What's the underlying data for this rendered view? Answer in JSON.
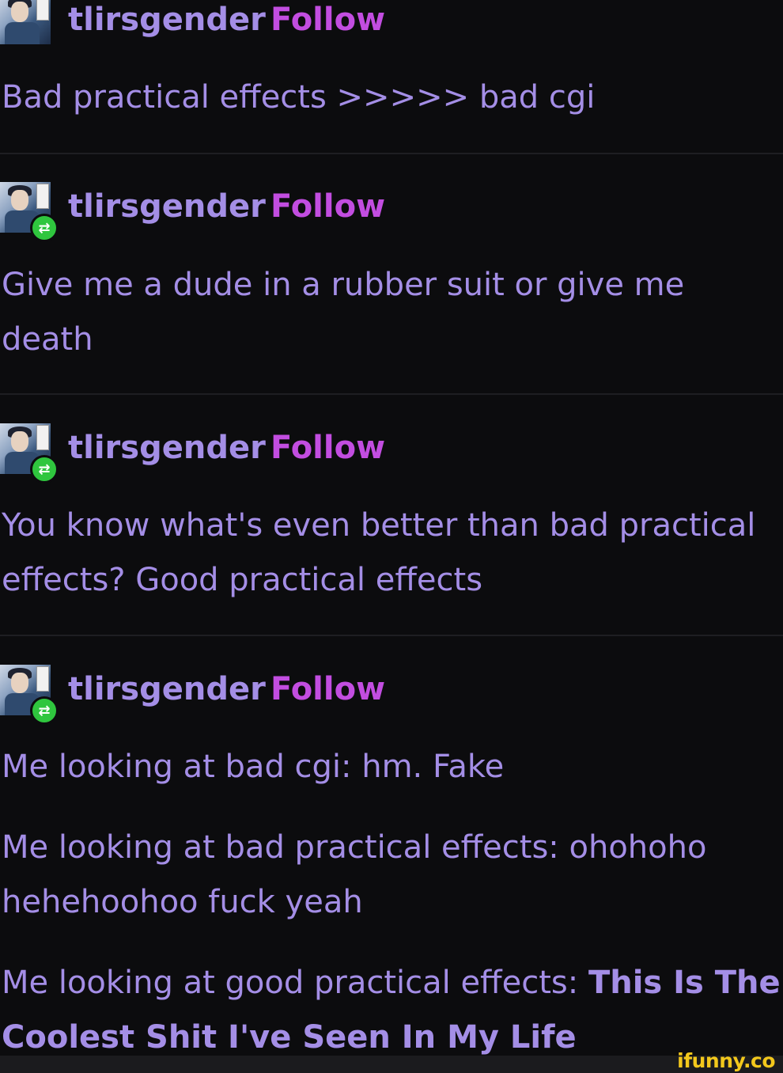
{
  "posts": [
    {
      "username": "tlirsgender",
      "follow_label": "Follow",
      "reblogged": false,
      "paragraphs": [
        "Bad practical effects >>>>> bad cgi"
      ]
    },
    {
      "username": "tlirsgender",
      "follow_label": "Follow",
      "reblogged": true,
      "paragraphs": [
        "Give me a dude in a rubber suit or give me death"
      ]
    },
    {
      "username": "tlirsgender",
      "follow_label": "Follow",
      "reblogged": true,
      "paragraphs": [
        "You know what's even better than bad practical effects? Good practical effects"
      ]
    },
    {
      "username": "tlirsgender",
      "follow_label": "Follow",
      "reblogged": true,
      "paragraphs": [
        "Me looking at bad cgi: hm. Fake",
        "Me looking at bad practical effects: ohohoho hehehoohoo fuck yeah",
        "Me looking at good practical effects:"
      ],
      "emphasis": "This Is The Coolest Shit I've Seen In My Life"
    }
  ],
  "icons": {
    "reblog": "reblog-icon",
    "avatar": "avatar-image"
  },
  "colors": {
    "background": "#0c0c0e",
    "text": "#a48ee6",
    "follow": "#c24de0",
    "reblog_badge": "#2fc63e",
    "watermark": "#f3c81c"
  },
  "watermark": "ifunny.co"
}
